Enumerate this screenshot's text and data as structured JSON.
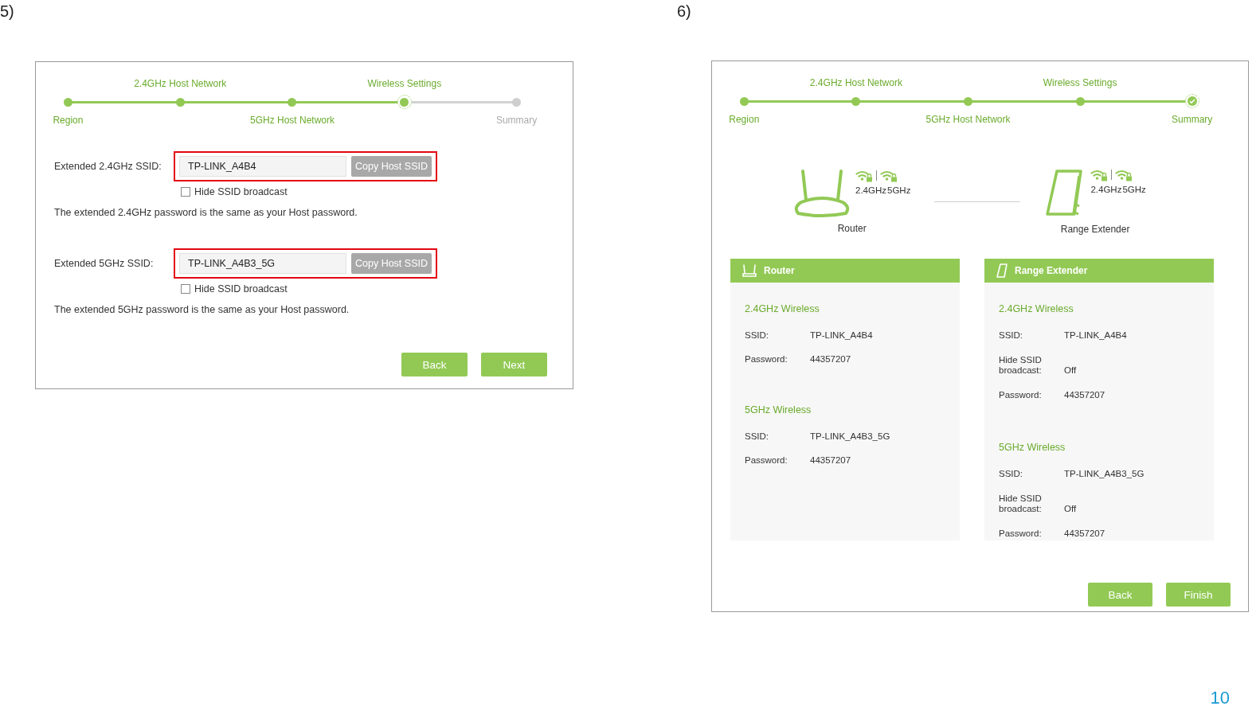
{
  "screens": [
    {
      "number": "5)",
      "kind": "wireless-settings",
      "stepper": [
        {
          "label": "Region",
          "done": true,
          "current": false
        },
        {
          "label": "2.4GHz Host Network",
          "done": true,
          "current": false
        },
        {
          "label": "5GHz Host Network",
          "done": true,
          "current": false
        },
        {
          "label": "Wireless Settings",
          "done": false,
          "current": true
        },
        {
          "label": "Summary",
          "done": false,
          "current": false
        }
      ],
      "fields": [
        {
          "label": "Extended 2.4GHz SSID:",
          "value": "TP-LINK_A4B4",
          "button": "Copy Host SSID",
          "highlighted": true,
          "hide_broadcast": {
            "label": "Hide SSID broadcast",
            "checked": false
          },
          "note": "The extended 2.4GHz password is the same as your Host password."
        },
        {
          "label": "Extended 5GHz SSID:",
          "value": "TP-LINK_A4B3_5G",
          "button": "Copy Host SSID",
          "highlighted": true,
          "hide_broadcast": {
            "label": "Hide SSID broadcast",
            "checked": false
          },
          "note": "The extended 5GHz password is the same as your Host password."
        }
      ],
      "buttons": [
        "Back",
        "Next"
      ]
    },
    {
      "number": "6)",
      "kind": "summary",
      "stepper": [
        {
          "label": "Region",
          "done": true,
          "current": false
        },
        {
          "label": "2.4GHz Host Network",
          "done": true,
          "current": false
        },
        {
          "label": "5GHz Host Network",
          "done": true,
          "current": false
        },
        {
          "label": "Wireless Settings",
          "done": true,
          "current": false
        },
        {
          "label": "Summary",
          "done": true,
          "current": true
        }
      ],
      "devices": [
        {
          "name": "Router",
          "kind": "router",
          "bands": [
            "2.4GHz",
            "5GHz"
          ]
        },
        {
          "name": "Range Extender",
          "kind": "extender",
          "bands": [
            "2.4GHz",
            "5GHz"
          ]
        }
      ],
      "cards": [
        {
          "title": "Router",
          "kind": "router",
          "sections": [
            {
              "title": "2.4GHz Wireless",
              "rows": [
                {
                  "label": "SSID:",
                  "value": "TP-LINK_A4B4"
                },
                {
                  "label": "Password:",
                  "value": "44357207"
                }
              ]
            },
            {
              "title": "5GHz Wireless",
              "rows": [
                {
                  "label": "SSID:",
                  "value": "TP-LINK_A4B3_5G"
                },
                {
                  "label": "Password:",
                  "value": "44357207"
                }
              ]
            }
          ]
        },
        {
          "title": "Range Extender",
          "kind": "extender",
          "sections": [
            {
              "title": "2.4GHz Wireless",
              "rows": [
                {
                  "label": "SSID:",
                  "value": "TP-LINK_A4B4"
                },
                {
                  "label": "Hide SSID broadcast:",
                  "value": "Off"
                },
                {
                  "label": "Password:",
                  "value": "44357207"
                }
              ]
            },
            {
              "title": "5GHz Wireless",
              "rows": [
                {
                  "label": "SSID:",
                  "value": "TP-LINK_A4B3_5G"
                },
                {
                  "label": "Hide SSID broadcast:",
                  "value": "Off"
                },
                {
                  "label": "Password:",
                  "value": "44357207"
                }
              ]
            }
          ]
        }
      ],
      "buttons": [
        "Back",
        "Finish"
      ]
    }
  ],
  "page_number": "10"
}
